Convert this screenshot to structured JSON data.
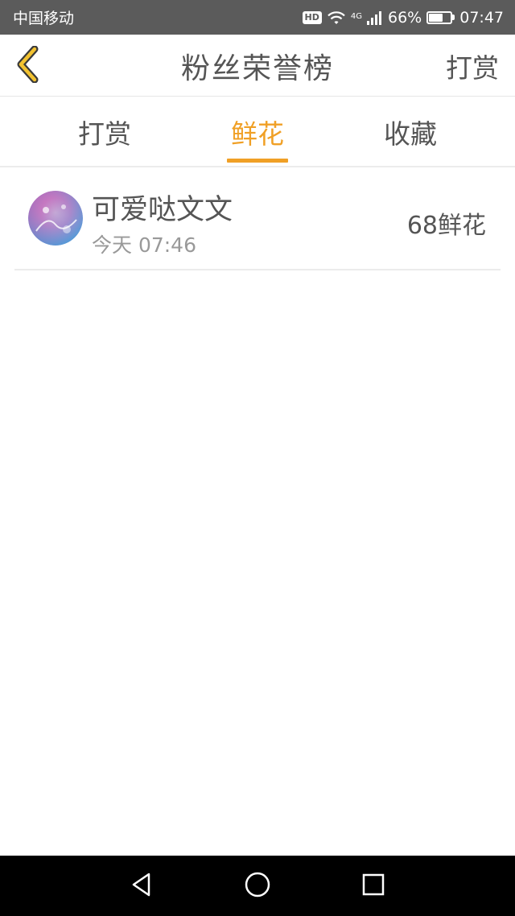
{
  "status_bar": {
    "carrier": "中国移动",
    "hd": "HD",
    "network": "4G",
    "battery_percent": "66%",
    "battery_level": 0.66,
    "time": "07:47"
  },
  "nav": {
    "title": "粉丝荣誉榜",
    "action_label": "打赏",
    "accent_color": "#f0a026"
  },
  "tabs": [
    {
      "label": "打赏",
      "active": false
    },
    {
      "label": "鲜花",
      "active": true
    },
    {
      "label": "收藏",
      "active": false
    }
  ],
  "list": [
    {
      "name": "可爱哒文文",
      "time": "今天 07:46",
      "count": "68鲜花",
      "avatar_icon": "user-avatar"
    }
  ],
  "icons": {
    "back": "chevron-left-icon",
    "sys_back": "triangle-back-icon",
    "sys_home": "circle-home-icon",
    "sys_recent": "square-recent-icon"
  }
}
